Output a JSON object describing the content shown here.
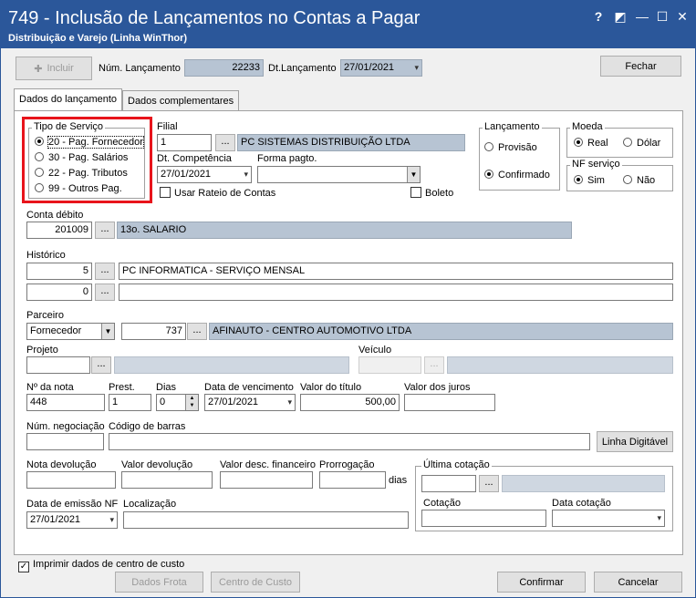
{
  "window": {
    "title": "749 - Inclusão de Lançamentos no Contas a Pagar",
    "subtitle": "Distribuição e Varejo (Linha WinThor)",
    "help_glyph": "?",
    "minimize_glyph": "—",
    "maximize_glyph": "☐",
    "close_glyph": "✕"
  },
  "toolbar": {
    "incluir": "Incluir",
    "num_lanc_label": "Núm. Lançamento",
    "num_lanc_value": "22233",
    "dt_lanc_label": "Dt.Lançamento",
    "dt_lanc_value": "27/01/2021",
    "fechar": "Fechar"
  },
  "tabs": [
    "Dados do lançamento",
    "Dados complementares"
  ],
  "tipo_servico": {
    "title": "Tipo de Serviço",
    "options": [
      "20 - Pag. Fornecedor",
      "30 - Pag. Salários",
      "22 - Pag. Tributos",
      "99 - Outros Pag."
    ],
    "selected_index": 0
  },
  "filial": {
    "label": "Filial",
    "code": "1",
    "name": "PC SISTEMAS DISTRIBUIÇÃO LTDA"
  },
  "dt_competencia": {
    "label": "Dt. Competência",
    "value": "27/01/2021"
  },
  "forma_pagto": {
    "label": "Forma pagto.",
    "value": ""
  },
  "usar_rateio": "Usar Rateio de Contas",
  "boleto": "Boleto",
  "lancamento": {
    "title": "Lançamento",
    "provisao": "Provisão",
    "confirmado": "Confirmado",
    "selected": "Confirmado"
  },
  "moeda": {
    "title": "Moeda",
    "real": "Real",
    "dolar": "Dólar",
    "selected": "Real"
  },
  "nf_servico": {
    "title": "NF serviço",
    "sim": "Sim",
    "nao": "Não",
    "selected": "Sim"
  },
  "conta_debito": {
    "label": "Conta débito",
    "code": "201009",
    "name": "13o. SALARIO"
  },
  "historico": {
    "label": "Histórico",
    "code1": "5",
    "text1": "PC INFORMATICA - SERVIÇO MENSAL",
    "code2": "0",
    "text2": ""
  },
  "parceiro": {
    "label": "Parceiro",
    "type": "Fornecedor",
    "code": "737",
    "name": "AFINAUTO - CENTRO AUTOMOTIVO LTDA"
  },
  "projeto": {
    "label": "Projeto"
  },
  "veiculo": {
    "label": "Veículo"
  },
  "nota": {
    "label": "Nº da nota",
    "value": "448"
  },
  "prest": {
    "label": "Prest.",
    "value": "1"
  },
  "dias": {
    "label": "Dias",
    "value": "0"
  },
  "vencimento": {
    "label": "Data de vencimento",
    "value": "27/01/2021"
  },
  "valor_titulo": {
    "label": "Valor do título",
    "value": "500,00"
  },
  "valor_juros": {
    "label": "Valor dos juros",
    "value": ""
  },
  "num_negociacao": {
    "label": "Núm. negociação"
  },
  "codigo_barras": {
    "label": "Código de barras"
  },
  "linha_digitavel": "Linha Digitável",
  "nota_devolucao": {
    "label": "Nota devolução"
  },
  "valor_devolucao": {
    "label": "Valor devolução"
  },
  "valor_desc": {
    "label": "Valor desc. financeiro"
  },
  "prorrogacao": {
    "label": "Prorrogação",
    "unit": "dias"
  },
  "ultima_cotacao": {
    "title": "Última cotação",
    "cotacao_label": "Cotação",
    "data_cotacao_label": "Data cotação"
  },
  "data_emissao": {
    "label": "Data de emissão NF",
    "value": "27/01/2021"
  },
  "localizacao": {
    "label": "Localização"
  },
  "imprimir_cc": "Imprimir dados de centro de custo",
  "footer": {
    "dados_frota": "Dados Frota",
    "centro_custo": "Centro de Custo",
    "confirmar": "Confirmar",
    "cancelar": "Cancelar"
  },
  "highlight_color": "#e8141b",
  "title_color": "#2b579a"
}
